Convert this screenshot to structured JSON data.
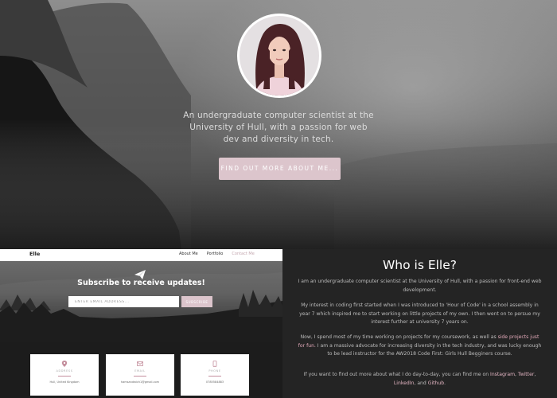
{
  "hero": {
    "tagline": "An undergraduate computer scientist at the University of Hull, with a passion for web dev and diversity in tech.",
    "cta_label": "FIND OUT MORE ABOUT ME..."
  },
  "nav": {
    "brand": "Elle",
    "links": [
      "About Me",
      "Portfolio",
      "Contact Me"
    ]
  },
  "subscribe": {
    "icon": "paper-plane-icon",
    "title": "Subscribe to receive updates!",
    "input_placeholder": "ENTER EMAIL ADDRESS...",
    "button_label": "SUBSCRIBE"
  },
  "contact": {
    "cards": [
      {
        "icon": "map-marker-icon",
        "label": "ADDRESS",
        "value": "Hull, United Kingdom"
      },
      {
        "icon": "envelope-icon",
        "label": "EMAIL",
        "value": "hamsandwich1@gmail.com"
      },
      {
        "icon": "phone-icon",
        "label": "PHONE",
        "value": "0785584883"
      }
    ]
  },
  "about": {
    "heading": "Who is Elle?",
    "p1": "I am an undergraduate computer scientist at the University of Hull, with a passion for front-end web development.",
    "p2": "My interest in coding first started when I was introduced to 'Hour of Code' in a school assembly in year 7 which inspired me to start working on little projects of my own. I then went on to persue my interest further at university 7 years on.",
    "p3_before": "Now, I spend most of my time working on projects for my coursework, as well as ",
    "p3_link": "side projects just for fun.",
    "p3_after": " I am a massive advocate for increasing diversity in the tech industry, and was lucky enough to be lead instructor for the AW2018 Code First: Girls Hull Begginers course.",
    "p4_before": "If you want to find out more about what I do day-to-day, you can find me on ",
    "links": [
      "Instagram",
      "Twitter",
      "LinkedIn",
      "Github"
    ],
    "sep_comma": ", ",
    "sep_and": ", and ",
    "end": "."
  },
  "colors": {
    "accent": "#dcc5cc",
    "link": "#e5b6c4",
    "about_bg": "#242424"
  }
}
